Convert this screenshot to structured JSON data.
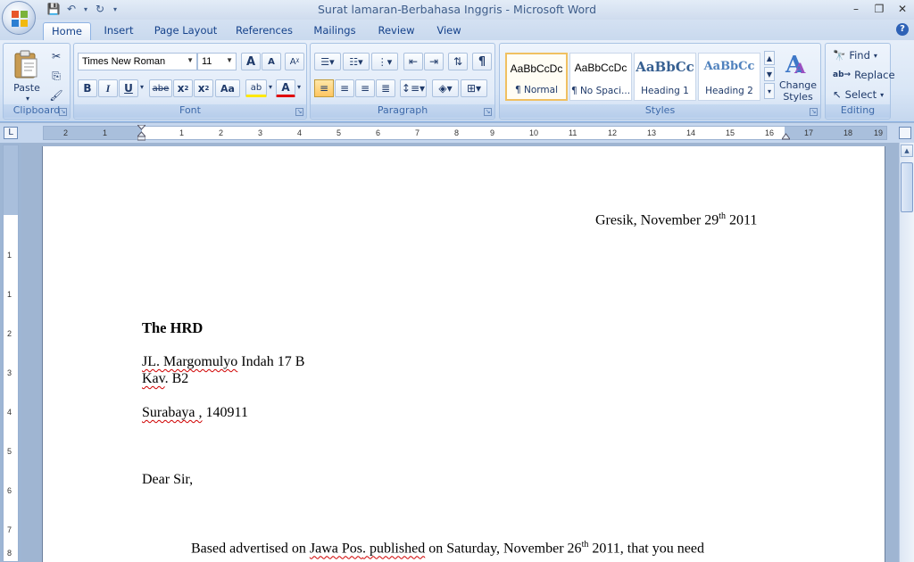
{
  "window": {
    "title": "Surat lamaran-Berbahasa Inggris - Microsoft Word",
    "minimize": "–",
    "restore": "❐",
    "close": "✕"
  },
  "qat": {
    "save": "💾",
    "undo": "↶",
    "redo": "↻",
    "dropdown": "▾"
  },
  "tabs": [
    "Home",
    "Insert",
    "Page Layout",
    "References",
    "Mailings",
    "Review",
    "View"
  ],
  "active_tab": "Home",
  "help": "?",
  "ribbon": {
    "clipboard": {
      "label": "Clipboard",
      "paste": "Paste"
    },
    "font": {
      "label": "Font",
      "font_name": "Times New Roman",
      "font_size": "11",
      "grow": "A",
      "shrink": "A",
      "bold": "B",
      "italic": "I",
      "underline": "U",
      "strike": "abe",
      "subscript": "x",
      "superscript": "x",
      "change_case": "Aa",
      "highlight": "ab",
      "font_color": "A"
    },
    "paragraph": {
      "label": "Paragraph",
      "pilcrow": "¶"
    },
    "styles": {
      "label": "Styles",
      "items": [
        {
          "sample": "AaBbCcDc",
          "name": "¶ Normal"
        },
        {
          "sample": "AaBbCcDc",
          "name": "¶ No Spaci..."
        },
        {
          "sample": "AaBbCc",
          "name": "Heading 1"
        },
        {
          "sample": "AaBbCc",
          "name": "Heading 2"
        }
      ],
      "change_styles": "Change Styles"
    },
    "editing": {
      "label": "Editing",
      "find": "Find",
      "replace": "Replace",
      "select": "Select"
    }
  },
  "ruler": {
    "corner": "L",
    "ticks": [
      "2",
      "1",
      "1",
      "2",
      "3",
      "4",
      "5",
      "6",
      "7",
      "8",
      "9",
      "10",
      "11",
      "12",
      "13",
      "14",
      "15",
      "16",
      "17",
      "18",
      "19"
    ],
    "vticks": [
      "1",
      "1",
      "2",
      "3",
      "4",
      "5",
      "6",
      "7",
      "8"
    ]
  },
  "document": {
    "date_prefix": "Gresik, November 29",
    "date_sup": "th",
    "date_suffix": " 2011",
    "recipient": "The HRD",
    "addr1_a": "JL. Margomulyo",
    "addr1_b": " Indah 17 B",
    "addr2_a": "Kav",
    "addr2_b": ". B2",
    "addr3_a": "Surabaya ,",
    "addr3_b": " 140911",
    "salutation": "Dear Sir,",
    "body_a": "Based advertised on ",
    "body_b": "Jawa Pos",
    "body_c": ". published",
    "body_d": " on Saturday, November 26",
    "body_sup": "th",
    "body_e": " 2011, that you need"
  },
  "colors": {
    "accent": "#15428b",
    "ribbon_bg": "#dbe7f7",
    "spell_error": "#d00000"
  }
}
